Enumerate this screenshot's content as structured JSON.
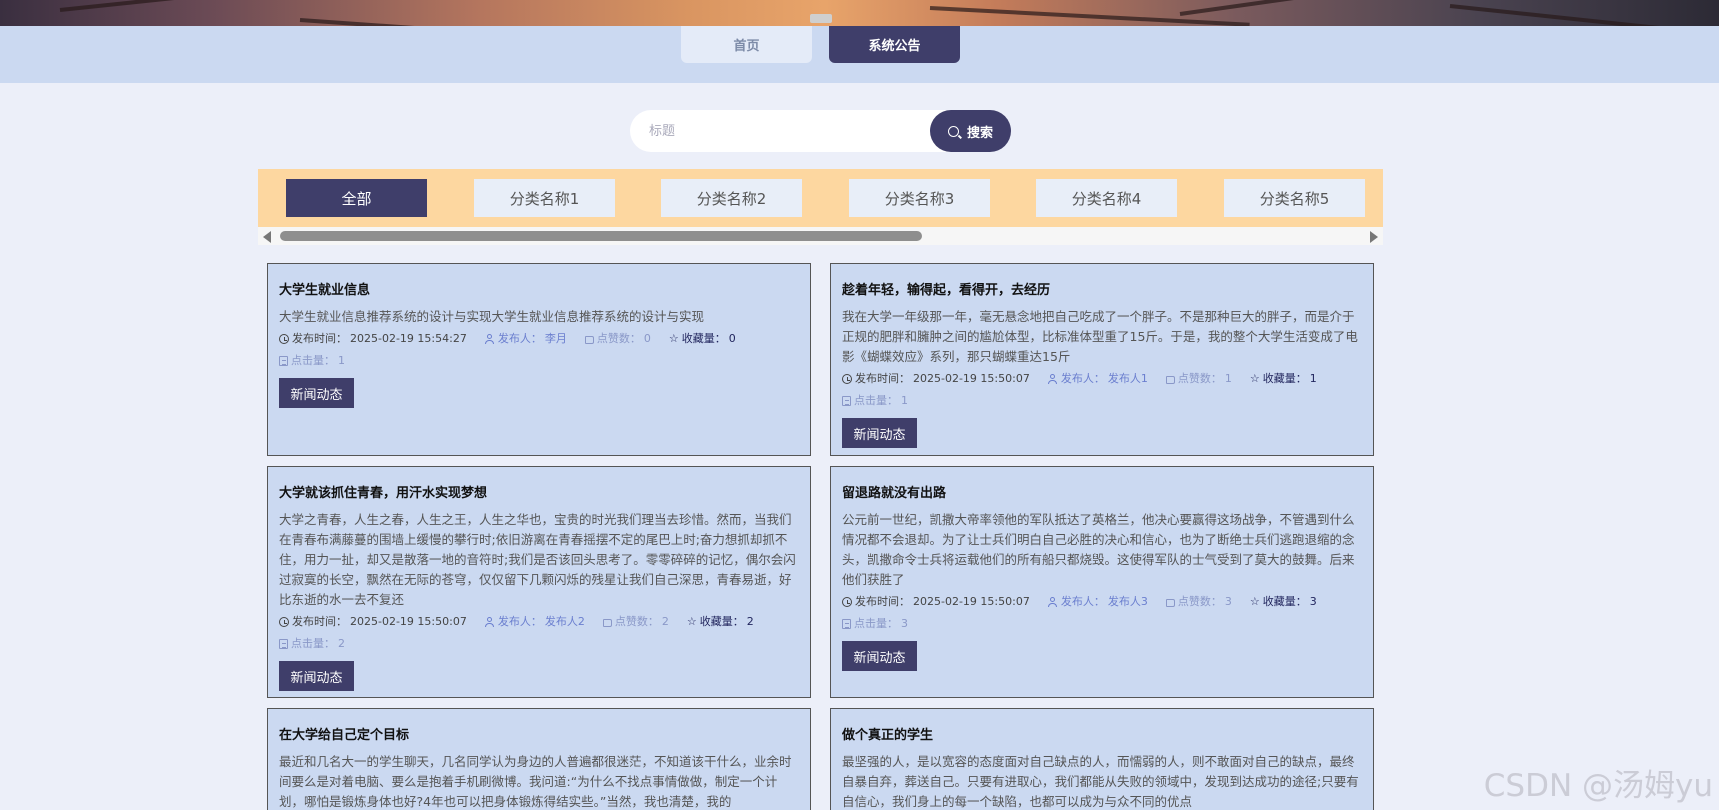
{
  "nav": {
    "items": [
      {
        "label": "首页",
        "active": false
      },
      {
        "label": "系统公告",
        "active": true
      }
    ]
  },
  "search": {
    "placeholder": "标题",
    "value": "",
    "button_label": "搜索"
  },
  "categories": [
    "全部",
    "分类名称1",
    "分类名称2",
    "分类名称3",
    "分类名称4",
    "分类名称5"
  ],
  "meta_labels": {
    "time": "发布时间：",
    "publisher": "发布人：",
    "likes": "点赞数：",
    "favorites": "收藏量：",
    "clicks": "点击量："
  },
  "articles": [
    {
      "title": "大学生就业信息",
      "desc": "大学生就业信息推荐系统的设计与实现大学生就业信息推荐系统的设计与实现",
      "time": "2025-02-19 15:54:27",
      "publisher": "李月",
      "likes": "0",
      "favorites": "0",
      "clicks": "1",
      "tag": "新闻动态"
    },
    {
      "title": "趁着年轻，输得起，看得开，去经历",
      "desc": "我在大学一年级那一年，毫无悬念地把自己吃成了一个胖子。不是那种巨大的胖子，而是介于正规的肥胖和臃肿之间的尴尬体型，比标准体型重了15斤。于是，我的整个大学生活变成了电影《蝴蝶效应》系列，那只蝴蝶重达15斤",
      "time": "2025-02-19 15:50:07",
      "publisher": "发布人1",
      "likes": "1",
      "favorites": "1",
      "clicks": "1",
      "tag": "新闻动态"
    },
    {
      "title": "大学就该抓住青春，用汗水实现梦想",
      "desc": "大学之青春，人生之春，人生之王，人生之华也，宝贵的时光我们理当去珍惜。然而，当我们在青春布满藤蔓的围墙上缓慢的攀行时;依旧游离在青春摇摆不定的尾巴上时;奋力想抓却抓不住，用力一扯，却又是散落一地的音符时;我们是否该回头思考了。零零碎碎的记忆，偶尔会闪过寂寞的长空，飘然在无际的苍穹，仅仅留下几颗闪烁的残星让我们自己深思，青春易逝，好比东逝的水一去不复还",
      "time": "2025-02-19 15:50:07",
      "publisher": "发布人2",
      "likes": "2",
      "favorites": "2",
      "clicks": "2",
      "tag": "新闻动态"
    },
    {
      "title": "留退路就没有出路",
      "desc": "公元前一世纪，凯撒大帝率领他的军队抵达了英格兰，他决心要赢得这场战争，不管遇到什么情况都不会退却。为了让士兵们明白自己必胜的决心和信心，也为了断绝士兵们逃跑退缩的念头，凯撒命令士兵将运载他们的所有船只都烧毁。这使得军队的士气受到了莫大的鼓舞。后来他们获胜了",
      "time": "2025-02-19 15:50:07",
      "publisher": "发布人3",
      "likes": "3",
      "favorites": "3",
      "clicks": "3",
      "tag": "新闻动态"
    },
    {
      "title": "在大学给自己定个目标",
      "desc": "最近和几名大一的学生聊天，几名同学认为身边的人普遍都很迷茫，不知道该干什么，业余时间要么是对着电脑、要么是抱着手机刷微博。我问道:“为什么不找点事情做做，制定一个计划，哪怕是锻炼身体也好?4年也可以把身体锻炼得结实些。”当然，我也清楚，我的",
      "time": "",
      "publisher": "",
      "likes": "",
      "favorites": "",
      "clicks": "",
      "tag": ""
    },
    {
      "title": "做个真正的学生",
      "desc": "最坚强的人，是以宽容的态度面对自己缺点的人，而懦弱的人，则不敢面对自己的缺点，最终自暴自弃，葬送自己。只要有进取心，我们都能从失败的领域中，发现到达成功的途径;只要有自信心，我们身上的每一个缺陷，也都可以成为与众不同的优点",
      "time": "",
      "publisher": "",
      "likes": "",
      "favorites": "",
      "clicks": "",
      "tag": ""
    }
  ],
  "watermark": "CSDN @汤姆yu"
}
